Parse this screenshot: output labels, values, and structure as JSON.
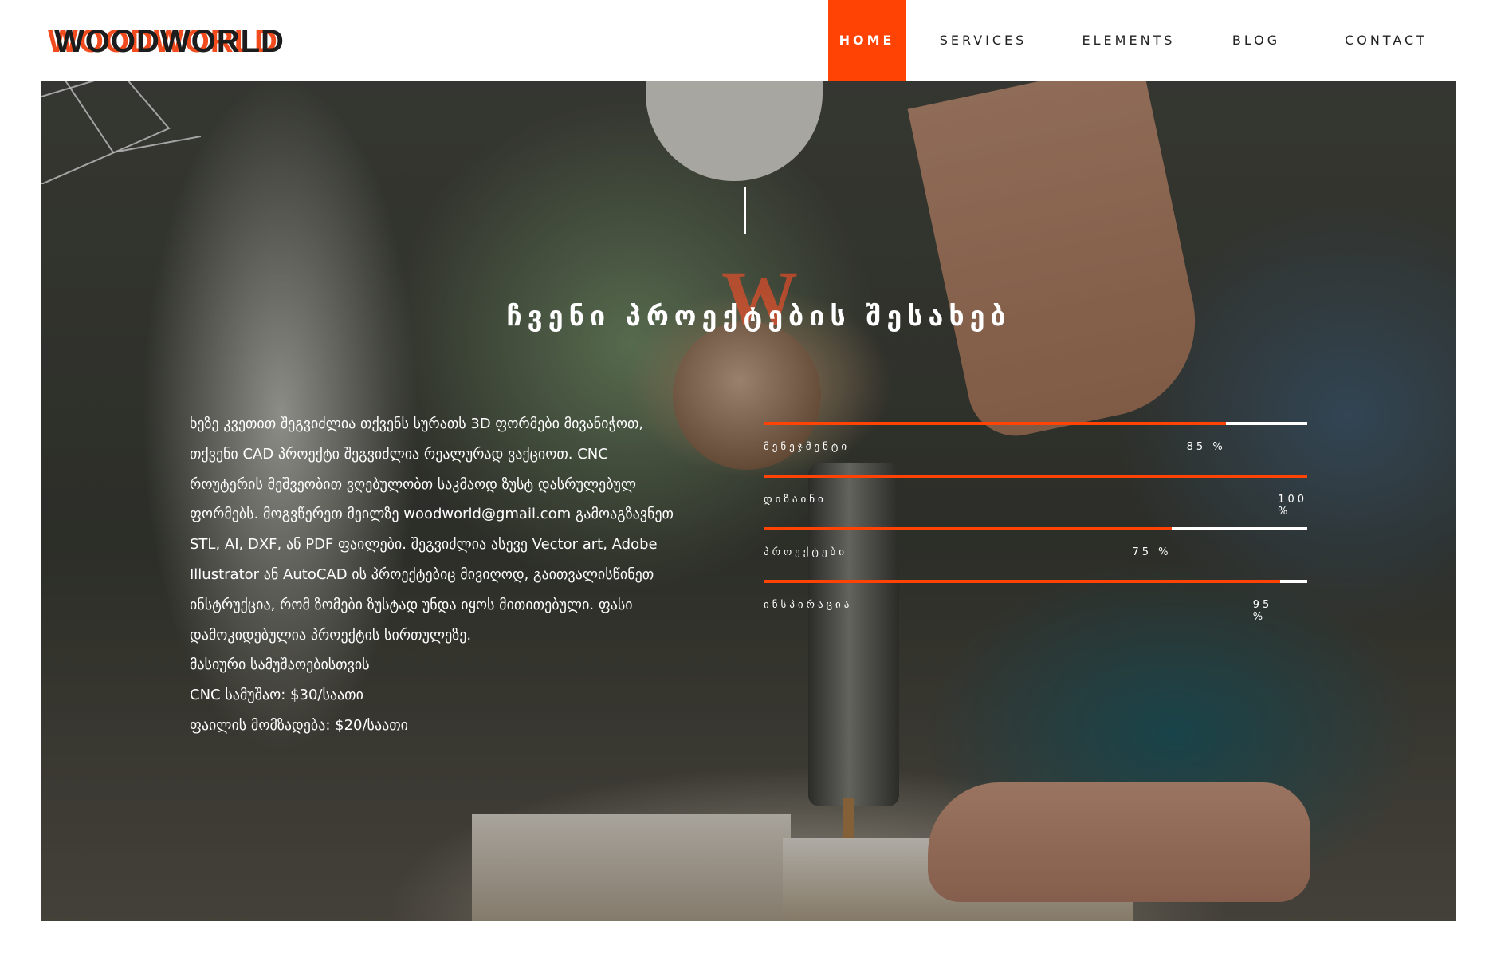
{
  "brand": {
    "logo_text": "WOODWORLD"
  },
  "nav": {
    "items": [
      {
        "label": "HOME",
        "active": true
      },
      {
        "label": "SERVICES",
        "active": false
      },
      {
        "label": "ELEMENTS",
        "active": false
      },
      {
        "label": "BLOG",
        "active": false
      },
      {
        "label": "CONTACT",
        "active": false
      }
    ]
  },
  "hero": {
    "badge_letter": "W",
    "title": "ჩვენი პროექტების შესახებ",
    "description": [
      "ხეზე კვეთით შეგვიძლია თქვენს სურათს 3D ფორმები მივანიჭოთ, თქვენი CAD პროექტი შეგვიძლია რეალურად ვაქციოთ. CNC როუტერის მეშვეობით ვღებულობთ საკმაოდ ზუსტ დასრულებულ ფორმებს. მოგვწერეთ მეილზე woodworld@gmail.com გამოაგზავნეთ STL, AI, DXF, ან PDF ფაილები. შეგვიძლია ასევე Vector art, Adobe Illustrator ან AutoCAD ის პროექტებიც მივიღოდ, გაითვალისწინეთ ინსტრუქცია, რომ ზომები ზუსტად უნდა იყოს მითითებული. ფასი დამოკიდებულია პროექტის სირთულეზე.",
      "მასიური სამუშაოებისთვის",
      "CNC სამუშაო: $30/საათი",
      "ფაილის მომზადება: $20/საათი"
    ]
  },
  "skills": [
    {
      "name": "მენეჯმენტი",
      "percent_label": "85 %",
      "value": 85
    },
    {
      "name": "დიზაინი",
      "percent_label": "100 %",
      "value": 100
    },
    {
      "name": "პროექტები",
      "percent_label": "75 %",
      "value": 75
    },
    {
      "name": "ინსპირაცია",
      "percent_label": "95 %",
      "value": 95
    }
  ],
  "colors": {
    "accent": "#ff4304",
    "text_light": "#ffffff",
    "text_dark": "#222222"
  }
}
